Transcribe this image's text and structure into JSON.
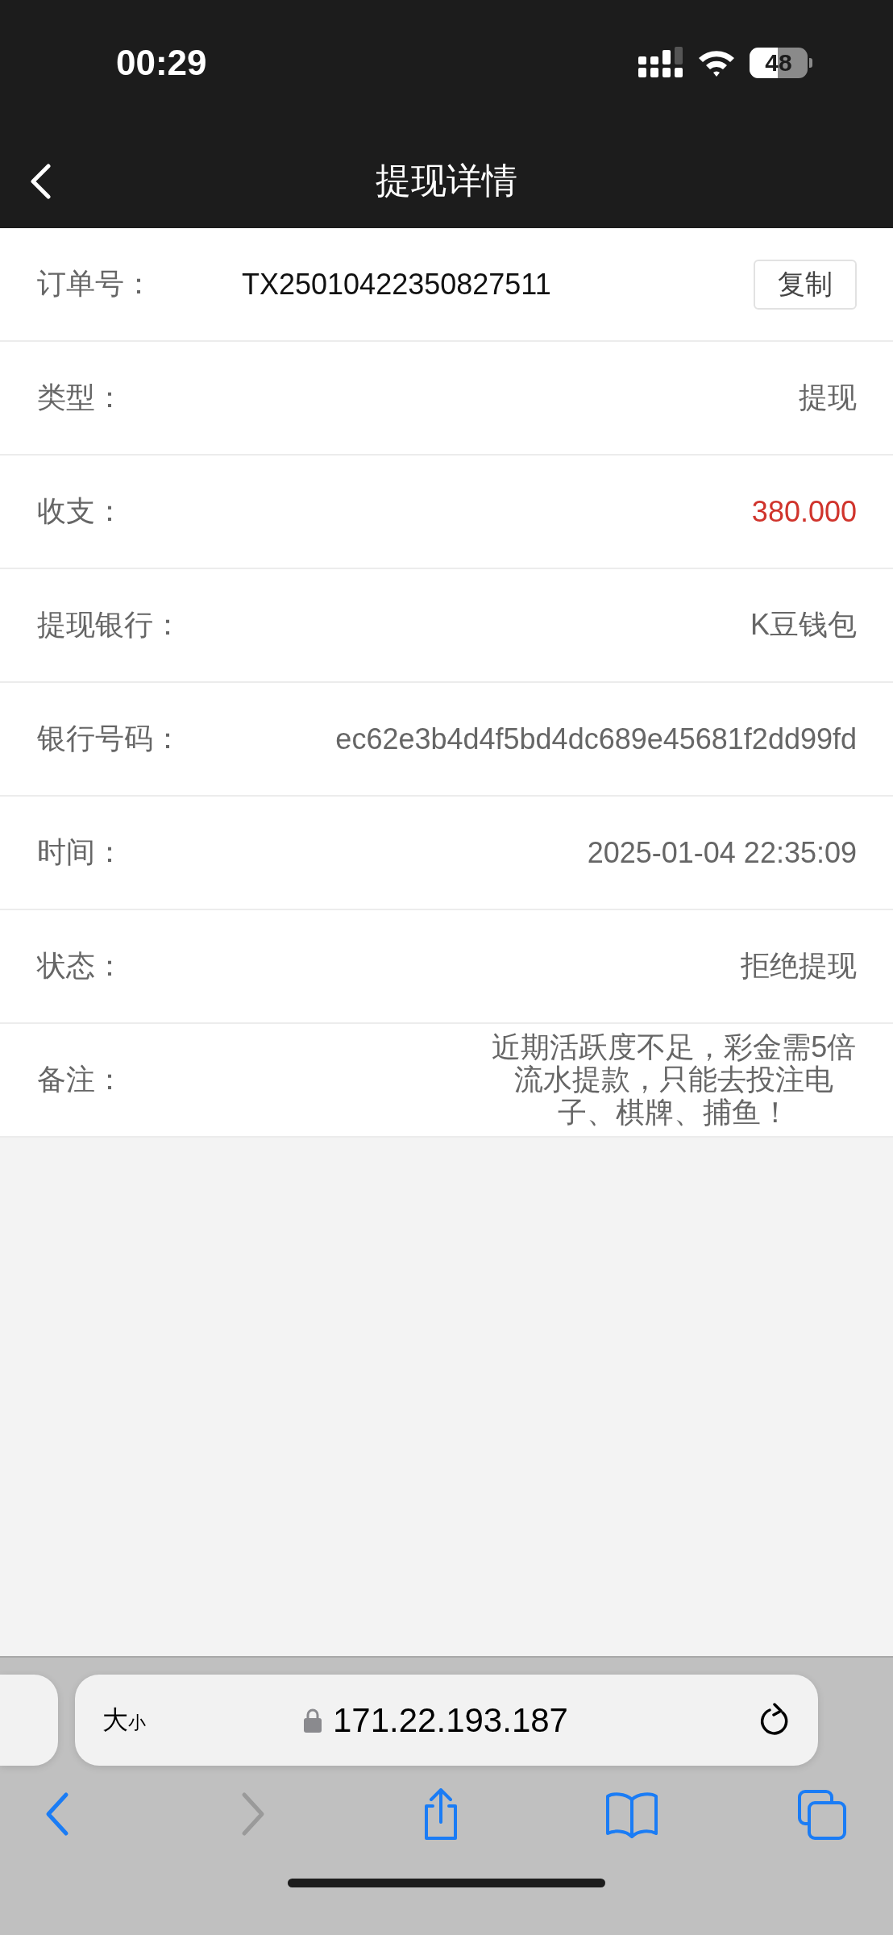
{
  "status_bar": {
    "time": "00:29",
    "battery": "48"
  },
  "nav": {
    "title": "提现详情"
  },
  "details": [
    {
      "kind": "copy",
      "label": "订单号：",
      "value": "TX25010422350827511",
      "button": "复制"
    },
    {
      "kind": "plain",
      "label": "类型：",
      "value": "提现"
    },
    {
      "kind": "amount",
      "label": "收支：",
      "value": "380.000"
    },
    {
      "kind": "plain",
      "label": "提现银行：",
      "value": "K豆钱包"
    },
    {
      "kind": "plain",
      "label": "银行号码：",
      "value": "ec62e3b4d4f5bd4dc689e45681f2dd99fd"
    },
    {
      "kind": "plain",
      "label": "时间：",
      "value": "2025-01-04 22:35:09"
    },
    {
      "kind": "plain",
      "label": "状态：",
      "value": "拒绝提现"
    },
    {
      "kind": "note",
      "label": "备注：",
      "value": "近期活跃度不足，彩金需5倍流水提款，只能去投注电子、棋牌、捕鱼！"
    }
  ],
  "browser": {
    "text_size_large": "大",
    "text_size_small": "小",
    "address": "171.22.193.187",
    "toolbar": [
      {
        "kind": "back",
        "disabled": false
      },
      {
        "kind": "forward",
        "disabled": true
      },
      {
        "kind": "share",
        "disabled": false
      },
      {
        "kind": "bookmarks",
        "disabled": false
      },
      {
        "kind": "tabs",
        "disabled": false
      }
    ]
  }
}
